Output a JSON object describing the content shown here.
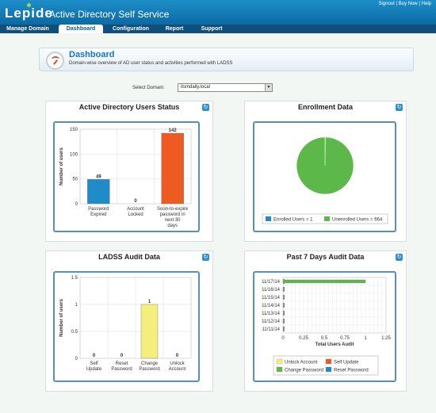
{
  "header": {
    "logo": "Lepide",
    "app_title": "Active Directory Self Service",
    "links": [
      "Signout",
      "Buy Now",
      "Help"
    ]
  },
  "nav": [
    {
      "label": "Manage Domain"
    },
    {
      "label": "Dashboard"
    },
    {
      "label": "Configuration"
    },
    {
      "label": "Report"
    },
    {
      "label": "Support"
    }
  ],
  "dashboard": {
    "title": "Dashboard",
    "subtitle": "Domain-wise overview of AD user status and activities performed with LADSS"
  },
  "domain_select": {
    "label": "Select Domain:",
    "value": "itsmdaily.local"
  },
  "panels": {
    "users_status": "Active Directory Users Status",
    "enrollment": "Enrollment Data",
    "audit": "LADSS Audit Data",
    "past7": "Past 7 Days Audit Data"
  },
  "colors": {
    "blue": "#1f8bc8",
    "orange": "#ef5a22",
    "green": "#5cb848",
    "yellow": "#f4ef7a",
    "header": "#1a86c2"
  },
  "chart_data": [
    {
      "type": "bar",
      "title": "Active Directory Users Status",
      "categories": [
        "Password Expired",
        "Account Locked",
        "Soon-to-expire password in next 30 days"
      ],
      "values": [
        49,
        0,
        142
      ],
      "bar_colors": [
        "#1f8bc8",
        "#1f8bc8",
        "#ef5a22"
      ],
      "ylabel": "Number of users",
      "ylim": [
        0,
        150
      ],
      "yticks": [
        "0",
        "50",
        "100",
        "150"
      ],
      "grid": true
    },
    {
      "type": "pie",
      "title": "Enrollment Data",
      "labels": [
        "Enrolled Users = 1",
        "Unenrolled Users = 664"
      ],
      "values": [
        1,
        664
      ],
      "colors": [
        "#1f8bc8",
        "#5cb848"
      ],
      "legend": "bottom"
    },
    {
      "type": "bar",
      "title": "LADSS Audit Data",
      "categories": [
        "Self Update",
        "Reset Password",
        "Change Password",
        "Unlock Account"
      ],
      "values": [
        0,
        0,
        1,
        0
      ],
      "bar_colors": [
        "#f4ef7a",
        "#f4ef7a",
        "#f4ef7a",
        "#f4ef7a"
      ],
      "ylabel": "Number of users",
      "ylim": [
        0,
        1.5
      ],
      "yticks": [
        "0",
        "0.5",
        "1",
        "1.5"
      ],
      "grid": true
    },
    {
      "type": "bar",
      "orientation": "horizontal",
      "title": "Past 7 Days Audit Data",
      "categories": [
        "11/17/14",
        "11/16/14",
        "11/15/14",
        "11/14/14",
        "11/13/14",
        "11/12/14",
        "11/11/14"
      ],
      "series": [
        {
          "name": "Change Password",
          "values": [
            1,
            0,
            0,
            0,
            0,
            0,
            0
          ],
          "color": "#5cb848"
        }
      ],
      "xlabel": "Total Users Audit",
      "xlim": [
        0,
        1.25
      ],
      "xticks": [
        "0",
        "0.25",
        "0.5",
        "0.75",
        "1",
        "1.25"
      ],
      "legend_items": [
        {
          "label": "Unlock Account",
          "color": "#f4ef7a"
        },
        {
          "label": "Self Update",
          "color": "#ef5a22"
        },
        {
          "label": "Change Password",
          "color": "#5cb848"
        },
        {
          "label": "Reset Password",
          "color": "#1f8bc8"
        }
      ],
      "grid": true
    }
  ]
}
